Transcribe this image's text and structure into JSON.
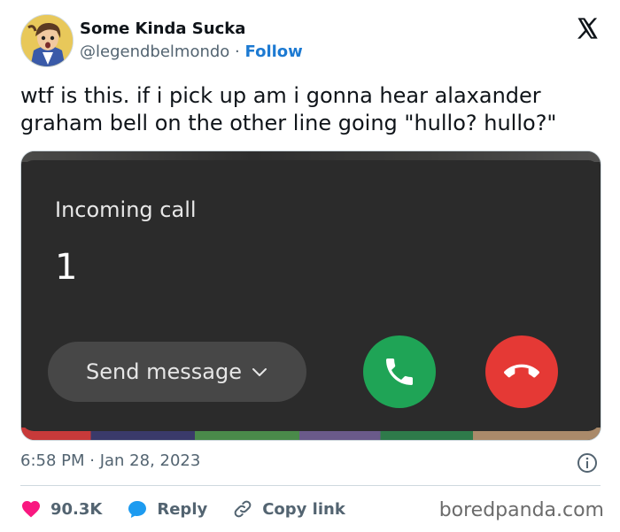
{
  "author": {
    "name": "Some Kinda Sucka",
    "handle": "@legendbelmondo",
    "separator": "·",
    "follow_label": "Follow"
  },
  "tweet": {
    "text": "wtf is this. if i pick up am i gonna hear alaxander graham bell on the other line going \"hullo? hullo?\"",
    "timestamp": "6:58 PM · Jan 28, 2023"
  },
  "screenshot": {
    "call_title": "Incoming call",
    "caller_number": "1",
    "send_message_label": "Send message",
    "accept_color": "#1fa456",
    "decline_color": "#e53935"
  },
  "actions": {
    "likes": "90.3K",
    "reply_label": "Reply",
    "copy_link_label": "Copy link"
  },
  "watermark": "boredpanda.com",
  "colors": {
    "follow": "#1d7ad2",
    "heart": "#f91880",
    "reply": "#1d9bf0",
    "muted": "#536471"
  }
}
